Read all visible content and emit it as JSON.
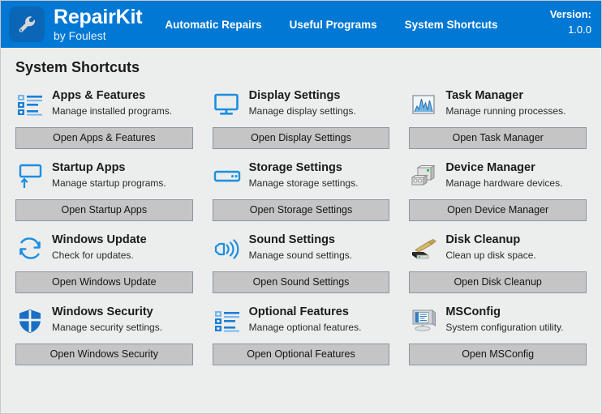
{
  "app": {
    "brand_name": "RepairKit",
    "brand_sub": "by Foulest",
    "logo_icon": "wrench-icon"
  },
  "header": {
    "nav": [
      {
        "label": "Automatic Repairs",
        "name": "nav-automatic-repairs"
      },
      {
        "label": "Useful Programs",
        "name": "nav-useful-programs"
      },
      {
        "label": "System Shortcuts",
        "name": "nav-system-shortcuts"
      }
    ],
    "version_label": "Version:",
    "version_value": "1.0.0",
    "accent_color": "#0078d4",
    "logo_bg_color": "#0c66b8"
  },
  "page": {
    "title": "System Shortcuts"
  },
  "shortcuts": [
    {
      "id": "apps-features",
      "icon": "list-settings-icon",
      "title": "Apps & Features",
      "desc": "Manage installed programs.",
      "button": "Open Apps & Features"
    },
    {
      "id": "display-settings",
      "icon": "monitor-icon",
      "title": "Display Settings",
      "desc": "Manage display settings.",
      "button": "Open Display Settings"
    },
    {
      "id": "task-manager",
      "icon": "chart-graph-icon",
      "title": "Task Manager",
      "desc": "Manage running processes.",
      "button": "Open Task Manager"
    },
    {
      "id": "startup-apps",
      "icon": "monitor-arrow-up-icon",
      "title": "Startup Apps",
      "desc": "Manage startup programs.",
      "button": "Open Startup Apps"
    },
    {
      "id": "storage-settings",
      "icon": "hard-drive-icon",
      "title": "Storage Settings",
      "desc": "Manage storage settings.",
      "button": "Open Storage Settings"
    },
    {
      "id": "device-manager",
      "icon": "computer-tower-icon",
      "title": "Device Manager",
      "desc": "Manage hardware devices.",
      "button": "Open Device Manager"
    },
    {
      "id": "windows-update",
      "icon": "refresh-circle-icon",
      "title": "Windows Update",
      "desc": "Check for updates.",
      "button": "Open Windows Update"
    },
    {
      "id": "sound-settings",
      "icon": "speaker-waves-icon",
      "title": "Sound Settings",
      "desc": "Manage sound settings.",
      "button": "Open Sound Settings"
    },
    {
      "id": "disk-cleanup",
      "icon": "disk-broom-icon",
      "title": "Disk Cleanup",
      "desc": "Clean up disk space.",
      "button": "Open Disk Cleanup"
    },
    {
      "id": "windows-security",
      "icon": "shield-icon",
      "title": "Windows Security",
      "desc": "Manage security settings.",
      "button": "Open Windows Security"
    },
    {
      "id": "optional-features",
      "icon": "list-settings-icon",
      "title": "Optional Features",
      "desc": "Manage optional features.",
      "button": "Open Optional Features"
    },
    {
      "id": "msconfig",
      "icon": "monitor-document-icon",
      "title": "MSConfig",
      "desc": "System configuration utility.",
      "button": "Open MSConfig"
    }
  ]
}
